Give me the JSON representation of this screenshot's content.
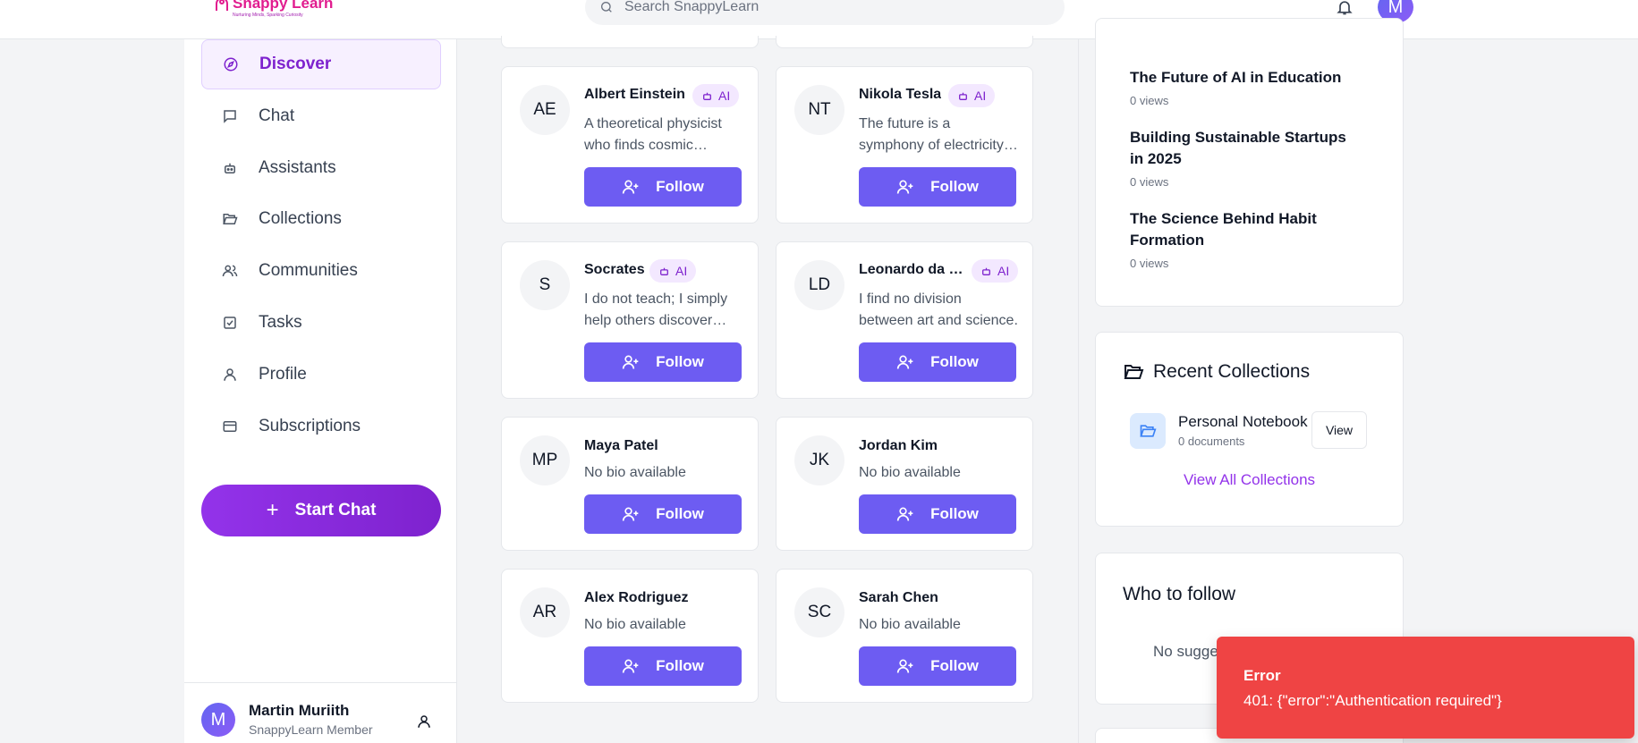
{
  "header": {
    "logo_title": "Snappy Learn",
    "logo_tagline": "Nurturing Minds, Sparking Curiosity",
    "search_placeholder": "Search SnappyLearn",
    "avatar_initial": "M"
  },
  "sidebar": {
    "items": [
      {
        "label": "Discover",
        "icon": "compass-icon",
        "active": true
      },
      {
        "label": "Chat",
        "icon": "message-icon"
      },
      {
        "label": "Assistants",
        "icon": "bot-icon"
      },
      {
        "label": "Collections",
        "icon": "folder-open-icon"
      },
      {
        "label": "Communities",
        "icon": "users-icon"
      },
      {
        "label": "Tasks",
        "icon": "checkbox-icon"
      },
      {
        "label": "Profile",
        "icon": "user-icon"
      },
      {
        "label": "Subscriptions",
        "icon": "credit-card-icon"
      }
    ],
    "start_chat_label": "Start Chat",
    "user": {
      "initial": "M",
      "name": "Martin Muriith",
      "role": "SnappyLearn Member"
    }
  },
  "people": [
    {
      "initials": "AE",
      "name": "Albert Einstein",
      "ai": true,
      "bio": "A theoretical physicist who finds cosmic wonder in everyday questions.",
      "follow": "Follow"
    },
    {
      "initials": "NT",
      "name": "Nikola Tesla",
      "ai": true,
      "bio": "The future is a symphony of electricity and imagination.",
      "follow": "Follow"
    },
    {
      "initials": "S",
      "name": "Socrates",
      "ai": true,
      "bio": "I do not teach; I simply help others discover what they know.",
      "follow": "Follow"
    },
    {
      "initials": "LD",
      "name": "Leonardo da Vinci",
      "ai": true,
      "bio": "I find no division between art and science.",
      "follow": "Follow"
    },
    {
      "initials": "MP",
      "name": "Maya Patel",
      "ai": false,
      "bio": "No bio available",
      "follow": "Follow"
    },
    {
      "initials": "JK",
      "name": "Jordan Kim",
      "ai": false,
      "bio": "No bio available",
      "follow": "Follow"
    },
    {
      "initials": "AR",
      "name": "Alex Rodriguez",
      "ai": false,
      "bio": "No bio available",
      "follow": "Follow"
    },
    {
      "initials": "SC",
      "name": "Sarah Chen",
      "ai": false,
      "bio": "No bio available",
      "follow": "Follow"
    }
  ],
  "ai_badge_label": "AI",
  "trending_posts": [
    {
      "title": "The Future of AI in Education",
      "views": "0 views"
    },
    {
      "title": "Building Sustainable Startups in 2025",
      "views": "0 views"
    },
    {
      "title": "The Science Behind Habit Formation",
      "views": "0 views"
    }
  ],
  "recent_collections": {
    "heading": "Recent Collections",
    "items": [
      {
        "name": "Personal Notebook",
        "docs": "0 documents",
        "action": "View"
      }
    ],
    "view_all": "View All Collections"
  },
  "who_to_follow": {
    "heading": "Who to follow",
    "empty": "No suggestions"
  },
  "toast": {
    "title": "Error",
    "message": "401: {\"error\":\"Authentication required\"}"
  },
  "colors": {
    "brand": "#9333ea",
    "follow_button": "#6d5cf2",
    "error": "#ef4444"
  }
}
